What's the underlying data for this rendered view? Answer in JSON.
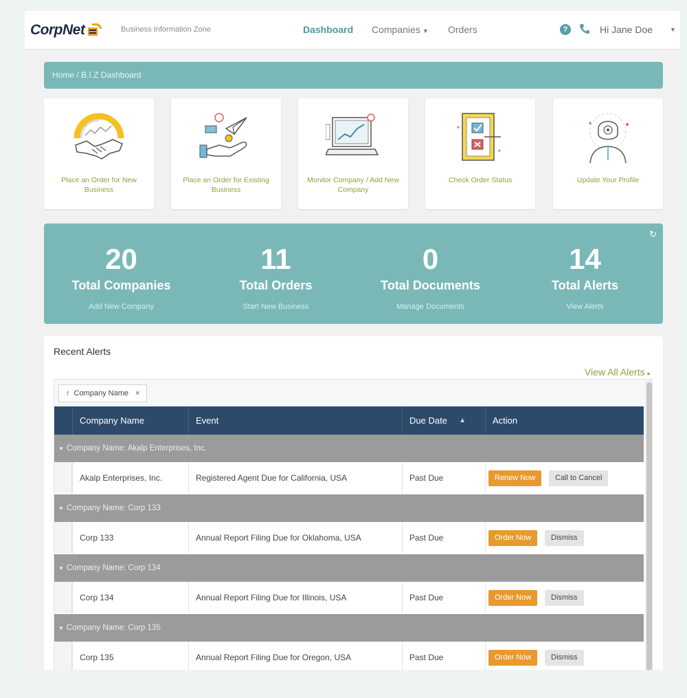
{
  "header": {
    "logo_text": "CorpNet",
    "subtitle": "Business Information Zone",
    "nav": [
      {
        "label": "Dashboard"
      },
      {
        "label": "Companies"
      },
      {
        "label": "Orders"
      }
    ],
    "help_glyph": "?",
    "user_name": "Hi Jane Doe",
    "icons": [
      "help-icon",
      "phone-icon",
      "chevron-down-icon"
    ]
  },
  "breadcrumb": {
    "home": "Home",
    "separator": "/",
    "current": "B.I.Z Dashboard"
  },
  "cards": [
    {
      "label": "Place an Order for New Business",
      "icon": "handshake-icon"
    },
    {
      "label": "Place an Order for Existing Business",
      "icon": "paper-plane-hand-icon"
    },
    {
      "label": "Monitor Company / Add New Company",
      "icon": "laptop-chart-icon"
    },
    {
      "label": "Check Order Status",
      "icon": "checklist-icon"
    },
    {
      "label": "Update Your Profile",
      "icon": "profile-avatar-icon"
    }
  ],
  "stats": [
    {
      "number": "20",
      "label": "Total Companies",
      "link": "Add New Company"
    },
    {
      "number": "11",
      "label": "Total Orders",
      "link": "Start New Business"
    },
    {
      "number": "0",
      "label": "Total Documents",
      "link": "Manage Documents"
    },
    {
      "number": "14",
      "label": "Total Alerts",
      "link": "View Alerts"
    }
  ],
  "refresh_glyph": "↻",
  "alerts": {
    "title": "Recent Alerts",
    "view_all": "View All Alerts",
    "view_all_caret": "▸",
    "group_chip": {
      "arrow": "↑",
      "label": "Company Name",
      "close": "×"
    },
    "columns": [
      {
        "label": "Company Name"
      },
      {
        "label": "Event"
      },
      {
        "label": "Due Date"
      },
      {
        "label": "Action"
      }
    ],
    "sort_glyph": "▲",
    "group_glyph": "▼",
    "groups": [
      {
        "header": "Company Name: Akalp Enterprises, Inc.",
        "company": "Akalp Enterprises, Inc.",
        "event": "Registered Agent Due for California, USA",
        "due": "Past Due",
        "primary_action": "Renew Now",
        "secondary_action": "Call to Cancel"
      },
      {
        "header": "Company Name: Corp 133",
        "company": "Corp 133",
        "event": "Annual Report Filing Due for Oklahoma, USA",
        "due": "Past Due",
        "primary_action": "Order Now",
        "secondary_action": "Dismiss"
      },
      {
        "header": "Company Name: Corp 134",
        "company": "Corp 134",
        "event": "Annual Report Filing Due for Illinois, USA",
        "due": "Past Due",
        "primary_action": "Order Now",
        "secondary_action": "Dismiss"
      },
      {
        "header": "Company Name: Corp 135",
        "company": "Corp 135",
        "event": "Annual Report Filing Due for Oregon, USA",
        "due": "Past Due",
        "primary_action": "Order Now",
        "secondary_action": "Dismiss"
      }
    ]
  },
  "colors": {
    "teal": "#7ab8b8",
    "navy_header": "#2e4a6a",
    "orange_button": "#e89a2e",
    "green_link": "#8ca23d",
    "group_gray": "#9b9b9b"
  }
}
